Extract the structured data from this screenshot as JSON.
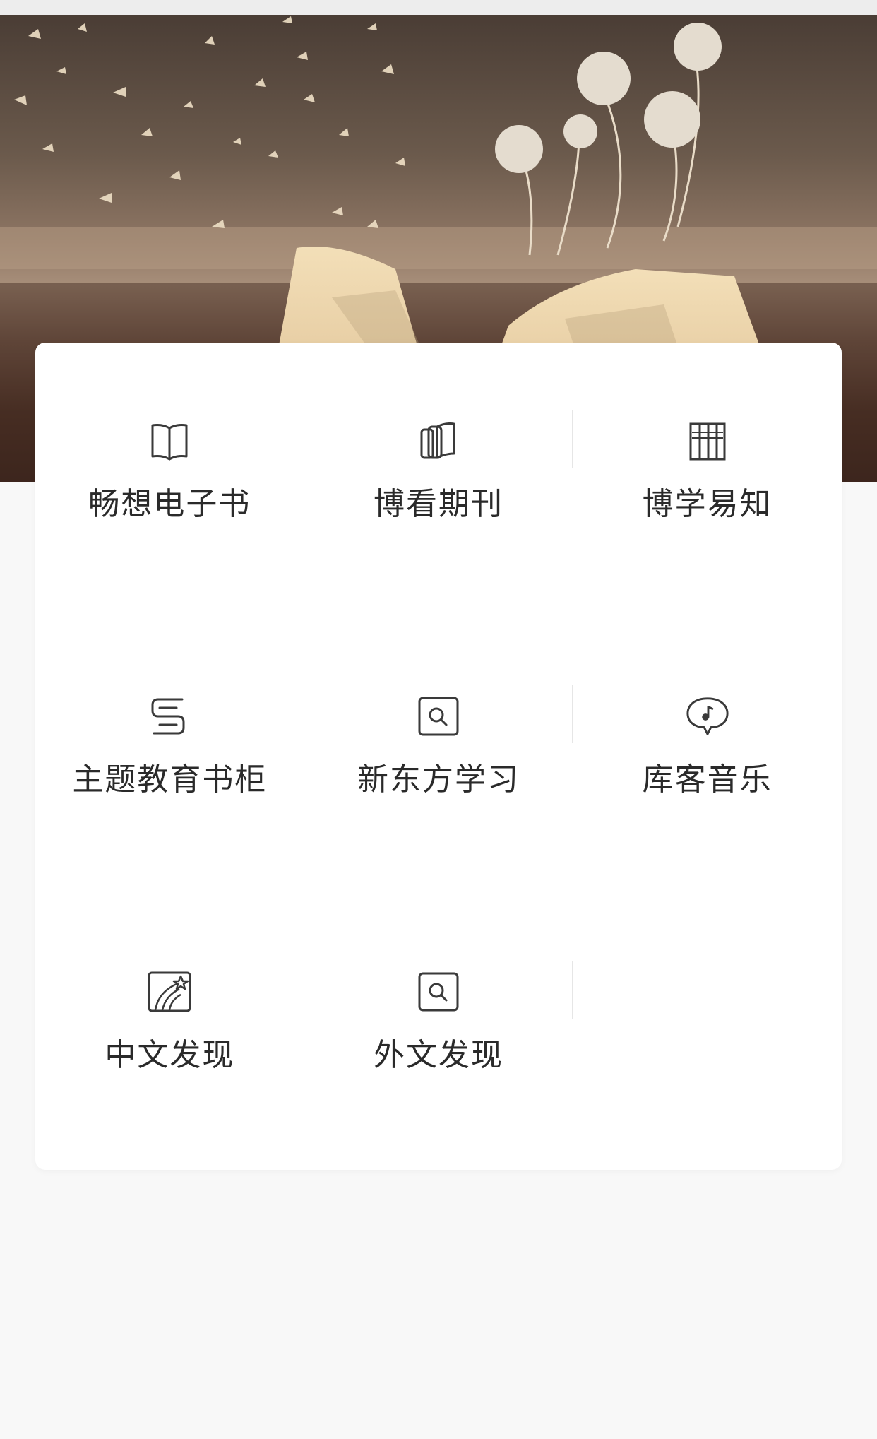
{
  "theme": {
    "card_bg": "#ffffff",
    "page_bg": "#f8f8f8",
    "icon_color": "#3a3a3a",
    "label_color": "#2a2a2a"
  },
  "banner": {
    "icon": "open-book-with-butterflies-illustration"
  },
  "menu": {
    "items": [
      {
        "label": "畅想电子书",
        "icon": "open-book-icon"
      },
      {
        "label": "博看期刊",
        "icon": "magazines-icon"
      },
      {
        "label": "博学易知",
        "icon": "bookshelf-icon"
      },
      {
        "label": "主题教育书柜",
        "icon": "s-logo-icon"
      },
      {
        "label": "新东方学习",
        "icon": "search-box-icon"
      },
      {
        "label": "库客音乐",
        "icon": "music-bubble-icon"
      },
      {
        "label": "中文发现",
        "icon": "shooting-star-icon"
      },
      {
        "label": "外文发现",
        "icon": "search-box-icon"
      }
    ]
  }
}
